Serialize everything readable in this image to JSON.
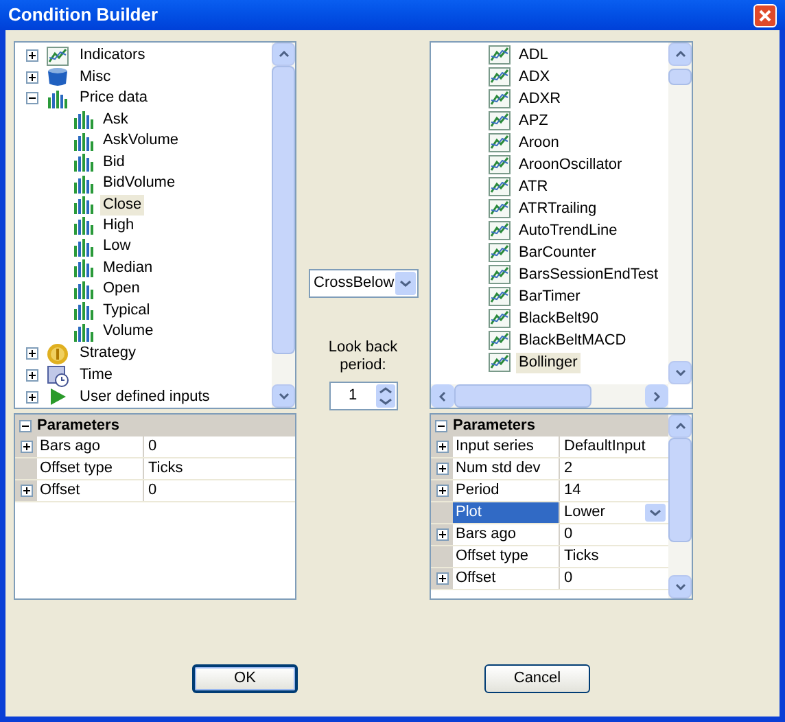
{
  "window": {
    "title": "Condition Builder"
  },
  "left": {
    "tree": [
      {
        "label": "Indicators",
        "kind": "indicator",
        "expanded": false,
        "selected": false
      },
      {
        "label": "Misc",
        "kind": "misc",
        "expanded": false,
        "selected": false
      },
      {
        "label": "Price data",
        "kind": "price",
        "expanded": true,
        "selected": false,
        "children": [
          {
            "label": "Ask",
            "selected": false
          },
          {
            "label": "AskVolume",
            "selected": false
          },
          {
            "label": "Bid",
            "selected": false
          },
          {
            "label": "BidVolume",
            "selected": false
          },
          {
            "label": "Close",
            "selected": true
          },
          {
            "label": "High",
            "selected": false
          },
          {
            "label": "Low",
            "selected": false
          },
          {
            "label": "Median",
            "selected": false
          },
          {
            "label": "Open",
            "selected": false
          },
          {
            "label": "Typical",
            "selected": false
          },
          {
            "label": "Volume",
            "selected": false
          }
        ]
      },
      {
        "label": "Strategy",
        "kind": "strategy",
        "expanded": false,
        "selected": false
      },
      {
        "label": "Time",
        "kind": "time",
        "expanded": false,
        "selected": false
      },
      {
        "label": "User defined inputs",
        "kind": "user",
        "expanded": false,
        "selected": false
      }
    ],
    "parameters": {
      "title": "Parameters",
      "expanded": true,
      "rows": [
        {
          "name": "Bars ago",
          "value": "0",
          "expandable": true,
          "selected": false
        },
        {
          "name": "Offset type",
          "value": "Ticks",
          "expandable": false,
          "selected": false
        },
        {
          "name": "Offset",
          "value": "0",
          "expandable": true,
          "selected": false
        }
      ]
    }
  },
  "operator": {
    "value": "CrossBelow"
  },
  "lookback": {
    "label": "Look back period:",
    "value": "1"
  },
  "right": {
    "list": [
      {
        "label": "ADL",
        "selected": false
      },
      {
        "label": "ADX",
        "selected": false
      },
      {
        "label": "ADXR",
        "selected": false
      },
      {
        "label": "APZ",
        "selected": false
      },
      {
        "label": "Aroon",
        "selected": false
      },
      {
        "label": "AroonOscillator",
        "selected": false
      },
      {
        "label": "ATR",
        "selected": false
      },
      {
        "label": "ATRTrailing",
        "selected": false
      },
      {
        "label": "AutoTrendLine",
        "selected": false
      },
      {
        "label": "BarCounter",
        "selected": false
      },
      {
        "label": "BarsSessionEndTest",
        "selected": false
      },
      {
        "label": "BarTimer",
        "selected": false
      },
      {
        "label": "BlackBelt90",
        "selected": false
      },
      {
        "label": "BlackBeltMACD",
        "selected": false
      },
      {
        "label": "Bollinger",
        "selected": true
      }
    ],
    "parameters": {
      "title": "Parameters",
      "expanded": true,
      "rows": [
        {
          "name": "Input series",
          "value": "DefaultInput",
          "expandable": true,
          "selected": false
        },
        {
          "name": "Num std dev",
          "value": "2",
          "expandable": true,
          "selected": false
        },
        {
          "name": "Period",
          "value": "14",
          "expandable": true,
          "selected": false
        },
        {
          "name": "Plot",
          "value": "Lower",
          "expandable": false,
          "selected": true
        },
        {
          "name": "Bars ago",
          "value": "0",
          "expandable": true,
          "selected": false
        },
        {
          "name": "Offset type",
          "value": "Ticks",
          "expandable": false,
          "selected": false
        },
        {
          "name": "Offset",
          "value": "0",
          "expandable": true,
          "selected": false
        }
      ]
    }
  },
  "buttons": [
    {
      "label": "OK",
      "default": true
    },
    {
      "label": "Cancel",
      "default": false
    }
  ]
}
